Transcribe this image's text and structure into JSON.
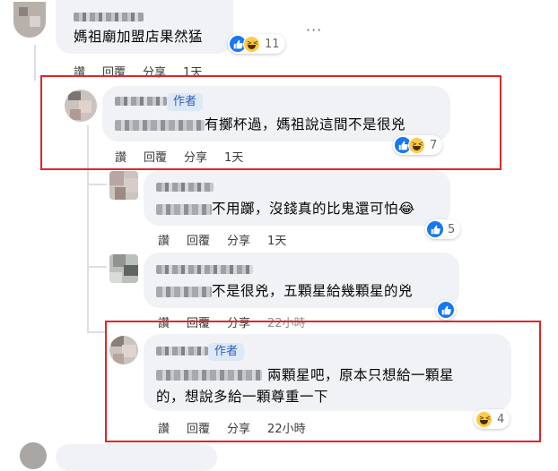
{
  "comments": [
    {
      "id": "c0",
      "text": "媽祖廟加盟店果然猛",
      "reaction_count": "11",
      "actions": [
        "讚",
        "回覆",
        "分享",
        "1天"
      ]
    },
    {
      "id": "c1",
      "author_tag": "作者",
      "text": "有擲杯過，媽祖說這間不是很兇",
      "reaction_count": "7",
      "actions": [
        "讚",
        "回覆",
        "分享",
        "1天"
      ]
    },
    {
      "id": "c2",
      "text": "不用躑，沒錢真的比鬼還可怕",
      "emoji": "😂",
      "reaction_count": "5",
      "actions": [
        "讚",
        "回覆",
        "分享",
        "1天"
      ]
    },
    {
      "id": "c3",
      "text": "不是很兇，五顆星給幾顆星的兇",
      "actions": [
        "讚",
        "回覆",
        "分享",
        "22小時"
      ]
    },
    {
      "id": "c4",
      "author_tag": "作者",
      "text_line1": "兩顆星吧，原本只想給一顆星",
      "text_line2": "的，想說多給一顆尊重一下",
      "reaction_count": "4",
      "actions": [
        "讚",
        "回覆",
        "分享",
        "22小時"
      ]
    }
  ],
  "more_options": "···",
  "colors": {
    "highlight_border": "#e0262a",
    "like_blue": "#1877f2",
    "bubble_bg": "#f0f2f5",
    "author_tag_bg": "#dde8f8"
  },
  "icons": [
    "like-icon",
    "haha-icon",
    "more-options-icon"
  ]
}
